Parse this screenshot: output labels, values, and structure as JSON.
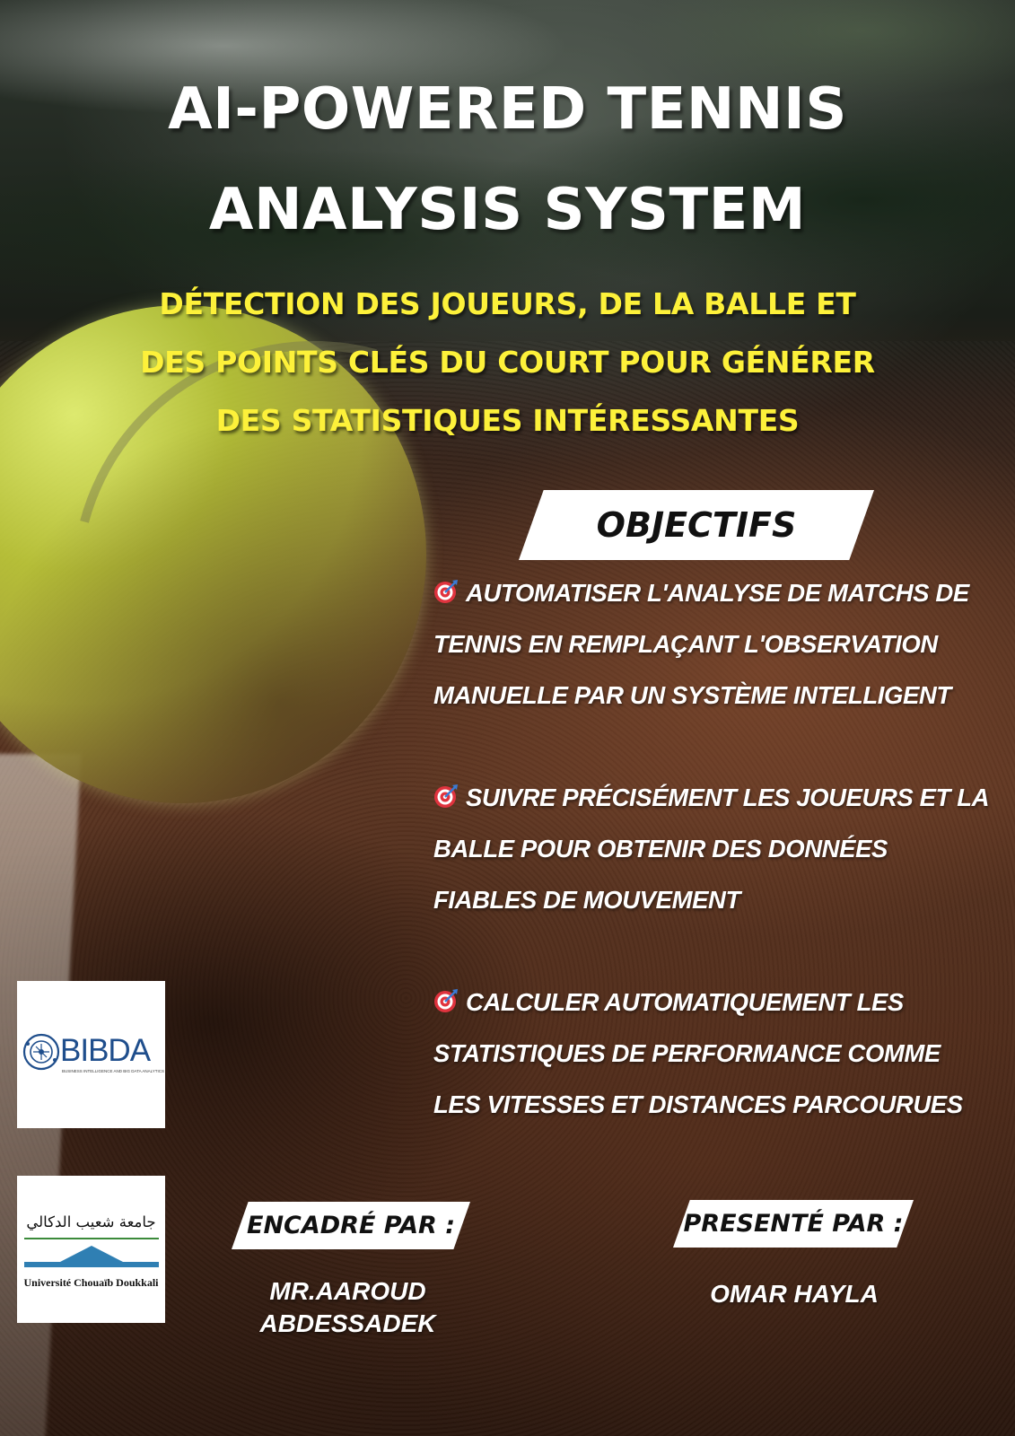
{
  "title": "AI-POWERED TENNIS ANALYSIS SYSTEM",
  "subtitle": "DÉTECTION DES JOUEURS, DE LA BALLE ET DES POINTS CLÉS DU COURT POUR GÉNÉRER DES STATISTIQUES INTÉRESSANTES",
  "objectives_heading": "OBJECTIFS",
  "objectives": [
    {
      "icon": "target-icon",
      "text": "AUTOMATISER L'ANALYSE DE MATCHS DE TENNIS EN REMPLAÇANT L'OBSERVATION MANUELLE PAR UN SYSTÈME INTELLIGENT"
    },
    {
      "icon": "target-icon",
      "text": "SUIVRE PRÉCISÉMENT LES JOUEURS ET LA BALLE POUR OBTENIR DES DONNÉES FIABLES DE MOUVEMENT"
    },
    {
      "icon": "target-icon",
      "text": "CALCULER AUTOMATIQUEMENT LES STATISTIQUES DE PERFORMANCE COMME LES VITESSES ET DISTANCES PARCOURUES"
    }
  ],
  "supervisor": {
    "label": "ENCADRÉ PAR :",
    "name_line1": "MR.AAROUD",
    "name_line2": "ABDESSADEK"
  },
  "presenter": {
    "label": "PRESENTÉ PAR :",
    "name": "OMAR HAYLA"
  },
  "logos": {
    "bibda": {
      "word": "BIBDA",
      "tagline": "BUSINESS INTELLIGENCE AND BIG DATA ANALYTICS"
    },
    "university": {
      "arabic": "جامعة شعيب الدكالي",
      "latin": "Université Chouaïb Doukkali"
    }
  },
  "colors": {
    "title": "#ffffff",
    "subtitle": "#fdf13a",
    "tag_background": "#ffffff",
    "tag_text": "#111111",
    "bibda_blue": "#1f4e8c",
    "target_red": "#e0333e"
  }
}
